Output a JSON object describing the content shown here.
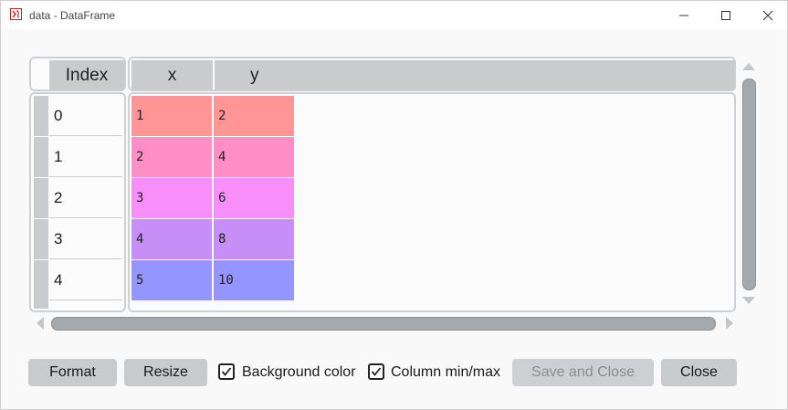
{
  "window": {
    "title": "data - DataFrame",
    "minimize_icon": "minimize-icon",
    "maximize_icon": "maximize-icon",
    "close_icon": "close-icon"
  },
  "table": {
    "index_header": "Index",
    "columns": [
      "x",
      "y"
    ],
    "index": [
      "0",
      "1",
      "2",
      "3",
      "4"
    ],
    "rows": [
      [
        "1",
        "2"
      ],
      [
        "2",
        "4"
      ],
      [
        "3",
        "6"
      ],
      [
        "4",
        "8"
      ],
      [
        "5",
        "10"
      ]
    ],
    "row_colors": [
      "#ff9595",
      "#ff8ec6",
      "#f78ef9",
      "#c78ef7",
      "#9595ff"
    ]
  },
  "buttons": {
    "format": "Format",
    "resize": "Resize",
    "save_close": "Save and Close",
    "close": "Close"
  },
  "checkboxes": {
    "background_color": {
      "label": "Background color",
      "checked": true
    },
    "column_minmax": {
      "label": "Column min/max",
      "checked": true
    }
  }
}
